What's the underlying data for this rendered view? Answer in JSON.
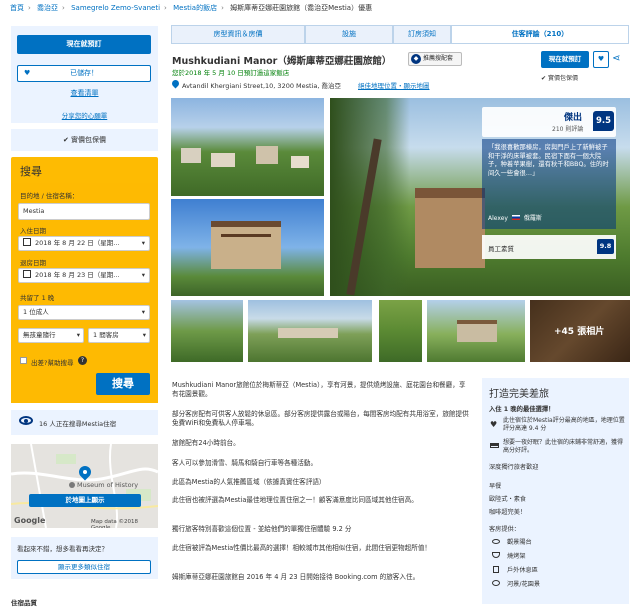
{
  "breadcrumbs": [
    "首頁",
    "喬治亞",
    "Samegrelo Zemo-Svaneti",
    "Mestia的飯店",
    "姆斯庫蒂亞娜莊園旅館（喬治亞Mestia）優惠"
  ],
  "sidebar": {
    "reserve_label": "現在就預訂",
    "saved_label": "已儲存！",
    "view_list_label": "查看清單",
    "share_label": "分享您的心願單",
    "price_match": "實價包保價",
    "search": {
      "title": "搜尋",
      "dest_label": "目的地 / 住宿名稱：",
      "dest_value": "Mestia",
      "checkin_label": "入住日期",
      "checkin_value": "2018 年 8 月 22 日（星期...",
      "checkout_label": "退房日期",
      "checkout_value": "2018 年 8 月 23 日（星期...",
      "nights_label": "共留了 1 晚",
      "adults_value": "1 位成人",
      "children_value": "無孩童隨行",
      "rooms_value": "1 間客房",
      "business_label": "出差?幫助搜尋",
      "search_button": "搜尋"
    },
    "watching": "16 人正在搜尋Mestia住宿",
    "map": {
      "label": "Museum of History",
      "button": "於地圖上顯示",
      "credit_left": "Google",
      "credit_right": "Map data ©2018 Google"
    },
    "recommend_text": "看起來不錯，想多看看再決定？",
    "recommend_button": "顯示更多類似住宿",
    "bottom_label": "住宿品質"
  },
  "tabs": [
    {
      "label": "房型資訊＆房價"
    },
    {
      "label": "設施"
    },
    {
      "label": "訂房須知"
    },
    {
      "label": "住客評論（210）"
    }
  ],
  "hotel": {
    "name": "Mushkudiani Manor（姆斯庫蒂亞娜莊園旅館）",
    "partner_since": "您於2018 年 5 月 10 日預訂過這家飯店",
    "badge_label": "推薦搜配套",
    "address": "Avtandil Khergiani Street,10, 3200 Mestia, 喬治亞",
    "address_link": "絕佳地理位置・顯示地圖",
    "reserve_label": "現在就預訂",
    "price_match": "實價包保價"
  },
  "review": {
    "word": "傑出",
    "count": "210 則評論",
    "score": "9.5",
    "quote": "「我很喜歡那棟房，房與門戶上了新鮮被子和干淨的床單被套。民宿下面有一個大院子，种着苹果樹，還有秋千和BBQ。住的时间久一些會很…」",
    "reviewer": "Alexey",
    "reviewer_country": "俄羅斯",
    "staff_label": "員工素質",
    "staff_score": "9.8"
  },
  "photos_more": "+45 張相片",
  "description": [
    "Mushkudiani Manor旅館位於梅斯蒂亞（Mestia），享有河景，提供燒烤設施、庭花園台和餐廳，享有花園景觀。",
    "部分客房配有可供客人放鬆的休息區。部分客房提供露台或陽台，每間客房均配有共用浴室，旅館提供免費WiFi和免費私人停車場。",
    "旅館配有24小時前台。",
    "客人可以參加滑雪、騎馬和騎自行車等各種活動。",
    "此區為Mestia的人氣推薦區域（依據真實住客評語）",
    "此住宿也被評選為Mestia最佳地理位置住宿之一！顧客滿意度比同區域其他住宿高。",
    "獨行旅客特別喜歡這個位置 - 並給他們的單獨住宿體驗 9.2 分",
    "此住宿被評為Mestia性價比最高的選擇！相較城市其他相似住宿，此間住宿更物超所值！",
    "姆斯庫蒂亞娜莊園旅館自 2016 年 4 月 23 日開始接待 Booking.com 的旅客入住。"
  ],
  "highlights": {
    "title": "打造完美差旅",
    "subtitle": "入住 1 晚的最佳選擇！",
    "item1": "此住宿位於Mestia評分最高的地區，地理位置評分高達 9.4 分",
    "item2": "想要一夜好眠？此住宿的床鋪非常舒適，獲得高分好評。",
    "parking": "深度獨行旅者歡迎",
    "breakfast_title": "早餐",
    "breakfast_value": "歐陸式・素食",
    "coffee": "咖啡超完美！",
    "facilities_title": "客房提供：",
    "fac1": "觀景陽台",
    "fac2": "燒烤架",
    "fac3": "戶外休息區",
    "fac4": "河景/花園景"
  },
  "colors": {
    "primary": "#0071c2",
    "yellow": "#febb02",
    "light_blue": "#ebf3ff",
    "dark_blue": "#003580"
  }
}
